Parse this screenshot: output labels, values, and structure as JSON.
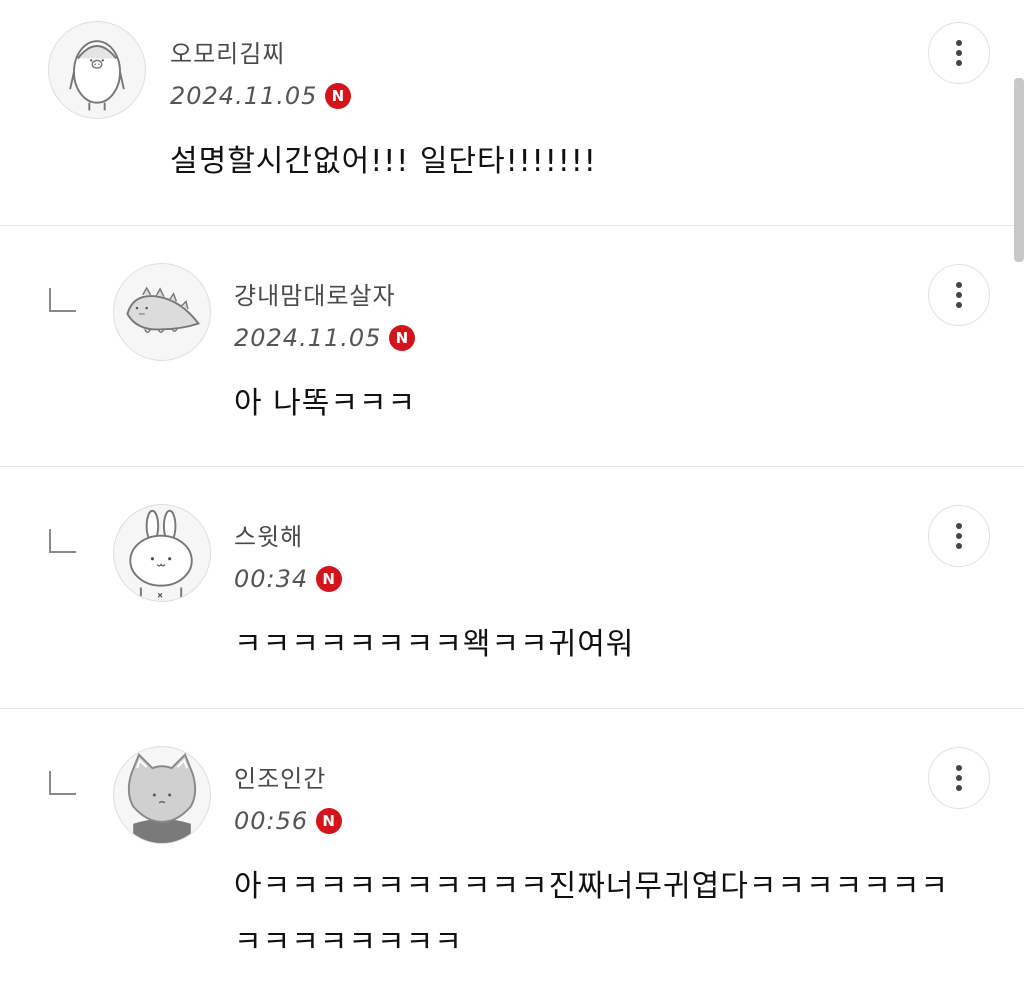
{
  "comments": [
    {
      "nickname": "오모리김찌",
      "date": "2024.11.05",
      "badge": "N",
      "text": "설명할시간없어!!! 일단타!!!!!!!",
      "avatar_icon": "penguin-avatar-icon",
      "is_reply": false
    },
    {
      "nickname": "걍내맘대로살자",
      "date": "2024.11.05",
      "badge": "N",
      "text": "아 나똑ㅋㅋㅋ",
      "avatar_icon": "dinosaur-avatar-icon",
      "is_reply": true
    },
    {
      "nickname": "스윗해",
      "date": "00:34",
      "badge": "N",
      "text": "ㅋㅋㅋㅋㅋㅋㅋㅋ왝ㅋㅋ귀여워",
      "avatar_icon": "rabbit-avatar-icon",
      "is_reply": true
    },
    {
      "nickname": "인조인간",
      "date": "00:56",
      "badge": "N",
      "text": "아ㅋㅋㅋㅋㅋㅋㅋㅋㅋㅋ진짜너무귀엽다ㅋㅋㅋㅋㅋㅋㅋ",
      "text_line2": "ㅋㅋㅋㅋㅋㅋㅋㅋ",
      "avatar_icon": "cat-avatar-icon",
      "is_reply": true
    }
  ],
  "more_button_icon": "more-vertical-icon",
  "reply_indicator_icon": "reply-corner-icon",
  "colors": {
    "badge_red": "#d3141b",
    "divider": "#e6e6e6",
    "text": "#111111",
    "meta": "#555555"
  }
}
